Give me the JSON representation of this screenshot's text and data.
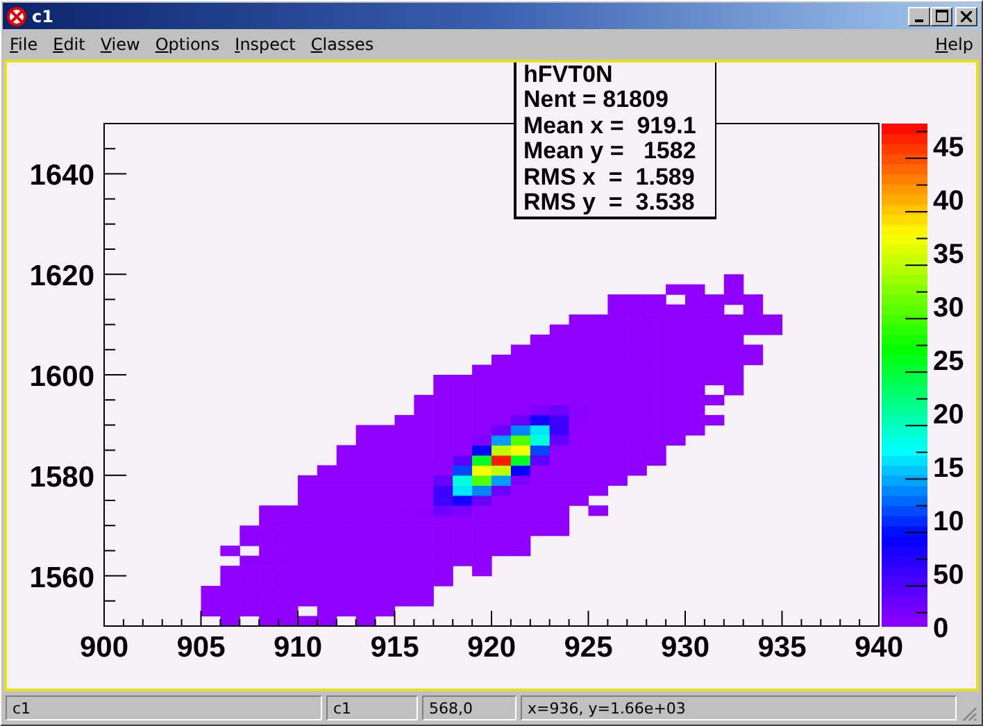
{
  "window": {
    "title": "c1"
  },
  "menu": {
    "items": [
      {
        "label": "File"
      },
      {
        "label": "Edit"
      },
      {
        "label": "View"
      },
      {
        "label": "Options"
      },
      {
        "label": "Inspect"
      },
      {
        "label": "Classes"
      }
    ],
    "help": "Help"
  },
  "stats": {
    "title": "hFVT0N",
    "lines": [
      "Nent = 81809",
      "Mean x =  919.1",
      "Mean y =   1582",
      "RMS x  =  1.589",
      "RMS y  =  3.538"
    ]
  },
  "plot": {
    "x_tick_labels": [
      "900",
      "905",
      "910",
      "915",
      "920",
      "925",
      "930",
      "935",
      "940"
    ],
    "y_tick_labels": [
      "1640",
      "1620",
      "1600",
      "1580",
      "1560"
    ],
    "palette_labels": [
      "45",
      "40",
      "35",
      "30",
      "25",
      "20",
      "15",
      "10",
      "50",
      "0"
    ]
  },
  "status_bar": [
    "c1",
    "c1",
    "568,0",
    "x=936, y=1.66e+03"
  ]
}
